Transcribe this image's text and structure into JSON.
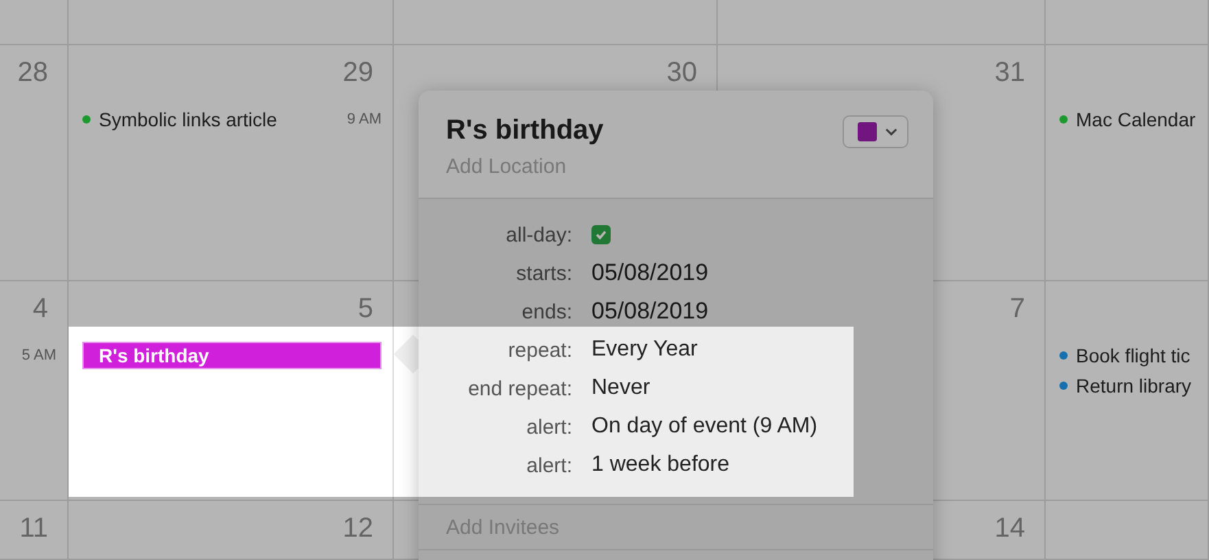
{
  "calendar": {
    "weeks": [
      {
        "column_1": {
          "number": "28"
        },
        "column_2": {
          "number": "29",
          "events": [
            {
              "kind": "dot",
              "title": "Symbolic links article",
              "time": "9 AM",
              "color": "#1c9a30"
            }
          ]
        },
        "column_3": {
          "number": "30"
        },
        "column_4": {
          "number": "31"
        },
        "column_5": {
          "events": [
            {
              "kind": "dot",
              "title": "Mac Calendar",
              "color": "#1c9a30"
            }
          ]
        }
      },
      {
        "column_1": {
          "number": "4",
          "events": [
            {
              "kind": "time",
              "time": "5 AM"
            }
          ]
        },
        "column_2": {
          "number": "5",
          "events": [
            {
              "kind": "bar",
              "title": "R's birthday",
              "color": "#d020dc",
              "selected": true
            }
          ]
        },
        "column_4": {
          "number": "7"
        },
        "column_5": {
          "events": [
            {
              "kind": "dot",
              "title": "Book flight tic",
              "color": "#1670b0"
            },
            {
              "kind": "dot",
              "title": "Return library",
              "color": "#1670b0"
            }
          ]
        }
      },
      {
        "column_1": {
          "number": "11"
        },
        "column_2": {
          "number": "12"
        },
        "column_4": {
          "number": "14"
        }
      }
    ]
  },
  "popover": {
    "title": "R's birthday",
    "location_placeholder": "Add Location",
    "fields": [
      {
        "kind": "checkbox",
        "label": "all-day:",
        "checked": true
      },
      {
        "kind": "date",
        "label": "starts:",
        "value": "05/08/2019"
      },
      {
        "kind": "date",
        "label": "ends:",
        "value": "05/08/2019"
      },
      {
        "kind": "text",
        "label": "repeat:",
        "value": "Every Year"
      },
      {
        "kind": "text",
        "label": "end repeat:",
        "value": "Never"
      },
      {
        "kind": "text",
        "label": "alert:",
        "value": "On day of event (9 AM)"
      },
      {
        "kind": "text",
        "label": "alert:",
        "value": "1 week before"
      }
    ],
    "invitees_placeholder": "Add Invitees"
  }
}
